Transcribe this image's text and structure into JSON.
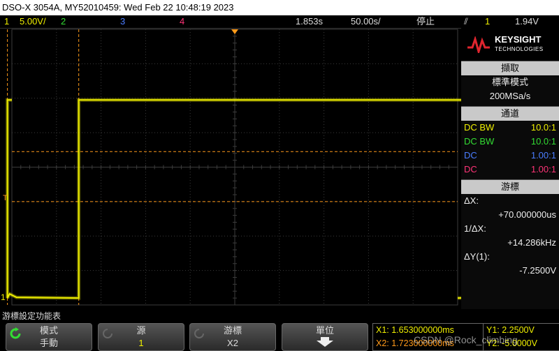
{
  "title": "DSO-X 3054A, MY52010459: Wed Feb 22 10:48:19 2023",
  "status": {
    "ch1_num": "1",
    "ch1_scale": "5.00V/",
    "ch2": "2",
    "ch3": "3",
    "ch4": "4",
    "timebase": "1.853s",
    "time_div": "50.00s/",
    "run_state": "停止",
    "trig_slope": "⫽",
    "trig_ch": "1",
    "trig_level": "1.94V"
  },
  "colors": {
    "ch1": "#f0f000",
    "ch2": "#33dd33",
    "ch3": "#4a7dff",
    "ch4": "#ff3377",
    "cursor": "#ff9a1a",
    "grid": "#3c3c3c"
  },
  "trace_markers": {
    "trigger": "T",
    "ch1": "1"
  },
  "panel": {
    "logo_main": "KEYSIGHT",
    "logo_sub": "TECHNOLOGIES",
    "acq_header": "擷取",
    "acq_mode": "標準模式",
    "acq_rate": "200MSa/s",
    "chan_header": "通道",
    "channels": [
      {
        "coupling": "DC BW",
        "probe": "10.0:1"
      },
      {
        "coupling": "DC BW",
        "probe": "10.0:1"
      },
      {
        "coupling": "DC",
        "probe": "1.00:1"
      },
      {
        "coupling": "DC",
        "probe": "1.00:1"
      }
    ],
    "cursor_header": "游標",
    "dx_label": "ΔX:",
    "dx_value": "+70.000000us",
    "inv_dx_label": "1/ΔX:",
    "inv_dx_value": "+14.286kHz",
    "dy_label": "ΔY(1):",
    "dy_value": "-7.2500V"
  },
  "func_label": "游標設定功能表",
  "softkeys": {
    "mode_title": "模式",
    "mode_value": "手動",
    "source_title": "源",
    "source_value": "1",
    "cursor_title": "游標",
    "cursor_value": "X2",
    "units_title": "單位"
  },
  "cursors": {
    "x1": "X1: 1.653000000ms",
    "x2": "X2: 1.723000000ms",
    "y1": "Y1: 2.2500V",
    "y2": "Y2: -5.0000V",
    "watermark": "CSDN @Rock_climbing"
  },
  "waveform": {
    "high_level_div": 1.95,
    "low_level_div": -3.8,
    "transitions_div": [
      -5.1,
      -3.5,
      5.35
    ],
    "x1_div": -5.1,
    "x2_div": -3.5,
    "y1_div": 0.45,
    "y2_div": -1.0
  }
}
